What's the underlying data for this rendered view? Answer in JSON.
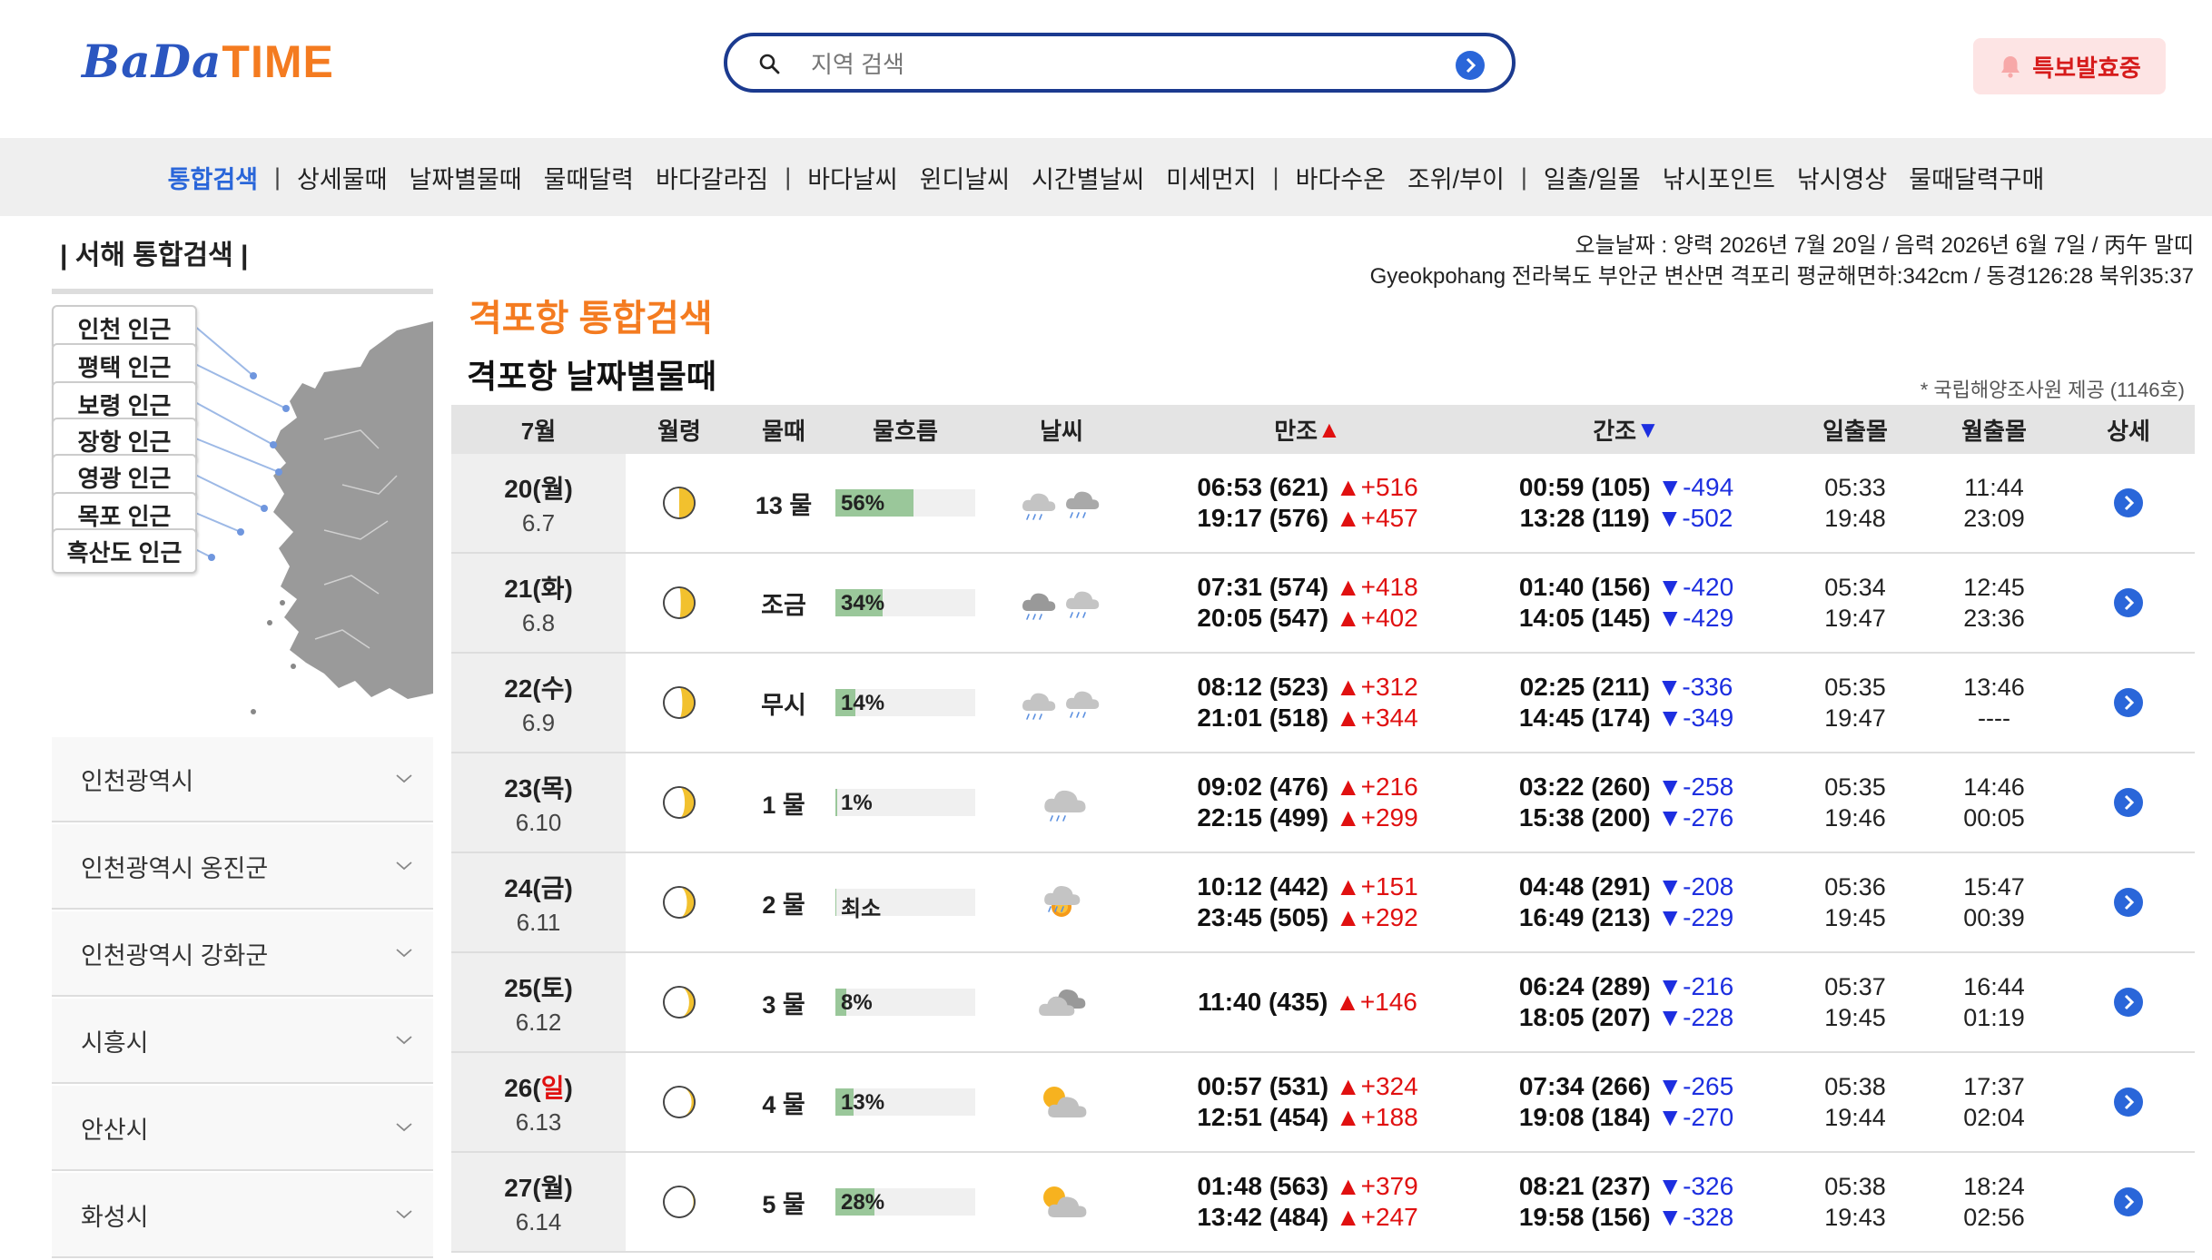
{
  "header": {
    "logo_left": "BaDa",
    "logo_right": "TIME",
    "search_placeholder": "지역 검색",
    "alert_button": "특보발효중"
  },
  "nav": [
    {
      "label": "통합검색",
      "active": true
    },
    {
      "label": "|",
      "sep": true
    },
    {
      "label": "상세물때"
    },
    {
      "label": "날짜별물때"
    },
    {
      "label": "물때달력"
    },
    {
      "label": "바다갈라짐"
    },
    {
      "label": "|",
      "sep": true
    },
    {
      "label": "바다날씨"
    },
    {
      "label": "윈디날씨"
    },
    {
      "label": "시간별날씨"
    },
    {
      "label": "미세먼지"
    },
    {
      "label": "|",
      "sep": true
    },
    {
      "label": "바다수온"
    },
    {
      "label": "조위/부이"
    },
    {
      "label": "|",
      "sep": true
    },
    {
      "label": "일출/일몰"
    },
    {
      "label": "낚시포인트"
    },
    {
      "label": "낚시영상"
    },
    {
      "label": "물때달력구매"
    }
  ],
  "sidebar": {
    "title": "| 서해 통합검색 |",
    "map_buttons": [
      "인천 인근",
      "평택 인근",
      "보령 인근",
      "장항 인근",
      "영광 인근",
      "목포 인근",
      "흑산도 인근"
    ],
    "regions": [
      "인천광역시",
      "인천광역시 옹진군",
      "인천광역시 강화군",
      "시흥시",
      "안산시",
      "화성시"
    ]
  },
  "info": {
    "date_line": "오늘날짜 : 양력 2026년 7월 20일 / 음력 2026년 6월 7일 / 丙午 말띠",
    "location_line": "Gyeokpohang 전라북도 부안군 변산면 격포리 평균해면하:342cm / 동경126:28 북위35:37"
  },
  "main": {
    "title": "격포항 통합검색",
    "subtitle": "격포항 날짜별물때",
    "provider": "* 국립해양조사원 제공 (1146호)"
  },
  "table": {
    "headers": [
      "7월",
      "월령",
      "물때",
      "물흐름",
      "날씨",
      "만조",
      "간조",
      "일출몰",
      "월출몰",
      "상세"
    ],
    "high_mark": "▲",
    "low_mark": "▼",
    "rows": [
      {
        "day": "20(월)",
        "lunar": "6.7",
        "moon": 0.5,
        "mul": "13 물",
        "flow": "56%",
        "flow_value": 56,
        "weather": "rain-rain",
        "high": [
          {
            "t": "06:53 (621)",
            "d": "+516"
          },
          {
            "t": "19:17 (576)",
            "d": "+457"
          }
        ],
        "low": [
          {
            "t": "00:59 (105)",
            "d": "-494"
          },
          {
            "t": "13:28 (119)",
            "d": "-502"
          }
        ],
        "sun": [
          "05:33",
          "19:48"
        ],
        "moonrise": [
          "11:44",
          "23:09"
        ]
      },
      {
        "day": "21(화)",
        "lunar": "6.8",
        "moon": 0.55,
        "mul": "조금",
        "flow": "34%",
        "flow_value": 34,
        "weather": "rain-dark-rain",
        "high": [
          {
            "t": "07:31 (574)",
            "d": "+418"
          },
          {
            "t": "20:05 (547)",
            "d": "+402"
          }
        ],
        "low": [
          {
            "t": "01:40 (156)",
            "d": "-420"
          },
          {
            "t": "14:05 (145)",
            "d": "-429"
          }
        ],
        "sun": [
          "05:34",
          "19:47"
        ],
        "moonrise": [
          "12:45",
          "23:36"
        ]
      },
      {
        "day": "22(수)",
        "lunar": "6.9",
        "moon": 0.6,
        "mul": "무시",
        "flow": "14%",
        "flow_value": 14,
        "weather": "rain-rain-light",
        "high": [
          {
            "t": "08:12 (523)",
            "d": "+312"
          },
          {
            "t": "21:01 (518)",
            "d": "+344"
          }
        ],
        "low": [
          {
            "t": "02:25 (211)",
            "d": "-336"
          },
          {
            "t": "14:45 (174)",
            "d": "-349"
          }
        ],
        "sun": [
          "05:35",
          "19:47"
        ],
        "moonrise": [
          "13:46",
          "----"
        ]
      },
      {
        "day": "23(목)",
        "lunar": "6.10",
        "moon": 0.68,
        "mul": "1 물",
        "flow": "1%",
        "flow_value": 1,
        "weather": "rain-single",
        "high": [
          {
            "t": "09:02 (476)",
            "d": "+216"
          },
          {
            "t": "22:15 (499)",
            "d": "+299"
          }
        ],
        "low": [
          {
            "t": "03:22 (260)",
            "d": "-258"
          },
          {
            "t": "15:38 (200)",
            "d": "-276"
          }
        ],
        "sun": [
          "05:35",
          "19:46"
        ],
        "moonrise": [
          "14:46",
          "00:05"
        ]
      },
      {
        "day": "24(금)",
        "lunar": "6.11",
        "moon": 0.75,
        "mul": "2 물",
        "flow": "최소",
        "flow_value": 0,
        "weather": "sun-cloud-rain",
        "high": [
          {
            "t": "10:12 (442)",
            "d": "+151"
          },
          {
            "t": "23:45 (505)",
            "d": "+292"
          }
        ],
        "low": [
          {
            "t": "04:48 (291)",
            "d": "-208"
          },
          {
            "t": "16:49 (213)",
            "d": "-229"
          }
        ],
        "sun": [
          "05:36",
          "19:45"
        ],
        "moonrise": [
          "15:47",
          "00:39"
        ]
      },
      {
        "day": "25(토)",
        "lunar": "6.12",
        "moon": 0.82,
        "mul": "3 물",
        "flow": "8%",
        "flow_value": 8,
        "weather": "cloud",
        "high": [
          {
            "t": "11:40 (435)",
            "d": "+146"
          }
        ],
        "low": [
          {
            "t": "06:24 (289)",
            "d": "-216"
          },
          {
            "t": "18:05 (207)",
            "d": "-228"
          }
        ],
        "sun": [
          "05:37",
          "19:45"
        ],
        "moonrise": [
          "16:44",
          "01:19"
        ]
      },
      {
        "day": "26(일)",
        "lunar": "6.13",
        "moon": 0.9,
        "mul": "4 물",
        "flow": "13%",
        "flow_value": 13,
        "weather": "sun-cloud",
        "high": [
          {
            "t": "00:57 (531)",
            "d": "+324"
          },
          {
            "t": "12:51 (454)",
            "d": "+188"
          }
        ],
        "low": [
          {
            "t": "07:34 (266)",
            "d": "-265"
          },
          {
            "t": "19:08 (184)",
            "d": "-270"
          }
        ],
        "sun": [
          "05:38",
          "19:44"
        ],
        "moonrise": [
          "17:37",
          "02:04"
        ]
      },
      {
        "day": "27(월)",
        "lunar": "6.14",
        "moon": 0.96,
        "mul": "5 물",
        "flow": "28%",
        "flow_value": 28,
        "weather": "sun-cloud",
        "high": [
          {
            "t": "01:48 (563)",
            "d": "+379"
          },
          {
            "t": "13:42 (484)",
            "d": "+247"
          }
        ],
        "low": [
          {
            "t": "08:21 (237)",
            "d": "-326"
          },
          {
            "t": "19:58 (156)",
            "d": "-328"
          }
        ],
        "sun": [
          "05:38",
          "19:43"
        ],
        "moonrise": [
          "18:24",
          "02:56"
        ]
      }
    ]
  },
  "colors": {
    "accent": "#2a66d9",
    "brand_orange": "#f47b20",
    "up": "#e01010",
    "down": "#1d2fe0",
    "sunday": "#e01010"
  }
}
